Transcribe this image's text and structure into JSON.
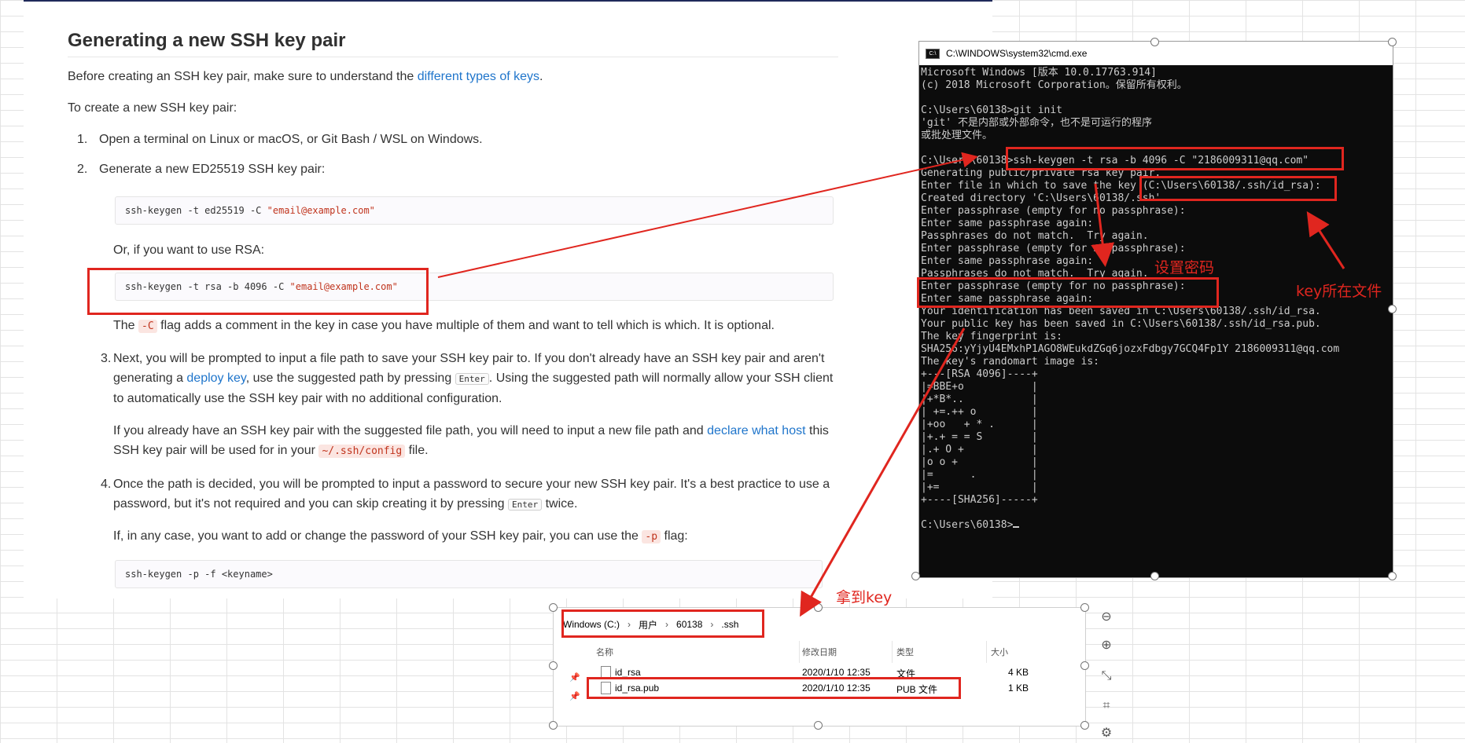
{
  "doc": {
    "title": "Generating a new SSH key pair",
    "intro_before": "Before creating an SSH key pair, make sure to understand the ",
    "intro_link": "different types of keys",
    "intro_after": ".",
    "create_intro": "To create a new SSH key pair:",
    "step1": {
      "num": "1.",
      "text": "Open a terminal on Linux or macOS, or Git Bash / WSL on Windows."
    },
    "step2": {
      "num": "2.",
      "text": "Generate a new ED25519 SSH key pair:"
    },
    "code1": {
      "cmd": "ssh-keygen -t ed25519 -C ",
      "str": "\"email@example.com\""
    },
    "rsa_intro": "Or, if you want to use RSA:",
    "code2": {
      "cmd": "ssh-keygen -t rsa -b 4096 -C ",
      "str": "\"email@example.com\""
    },
    "flag_pre": "The ",
    "flag_code": "-C",
    "flag_post": " flag adds a comment in the key in case you have multiple of them and want to tell which is which. It is optional.",
    "step3": {
      "num": "3.",
      "part1": "Next, you will be prompted to input a file path to save your SSH key pair to. If you don't already have an SSH key pair and aren't generating a ",
      "link": "deploy key",
      "part2": ", use the suggested path by pressing ",
      "kbd": "Enter",
      "part3": ". Using the suggested path will normally allow your SSH client to automatically use the SSH key pair with no additional configuration."
    },
    "step3b": {
      "part1": "If you already have an SSH key pair with the suggested file path, you will need to input a new file path and ",
      "link": "declare what host",
      "part2": " this SSH key pair will be used for in your ",
      "code": "~/.ssh/config",
      "part3": " file."
    },
    "step4": {
      "num": "4.",
      "part1": "Once the path is decided, you will be prompted to input a password to secure your new SSH key pair. It's a best practice to use a password, but it's not required and you can skip creating it by pressing ",
      "kbd": "Enter",
      "part2": " twice."
    },
    "step4b": {
      "part1": "If, in any case, you want to add or change the password of your SSH key pair, you can use the ",
      "code": "-p",
      "part2": " flag:"
    },
    "code3": {
      "cmd": "ssh-keygen -p -f <keyname>"
    }
  },
  "cmd": {
    "title": "C:\\WINDOWS\\system32\\cmd.exe",
    "icon_label": "C:\\",
    "lines": [
      "Microsoft Windows [版本 10.0.17763.914]",
      "(c) 2018 Microsoft Corporation。保留所有权利。",
      "",
      "C:\\Users\\60138>git init",
      "'git' 不是内部或外部命令，也不是可运行的程序",
      "或批处理文件。",
      "",
      "C:\\Users\\60138>ssh-keygen -t rsa -b 4096 -C \"2186009311@qq.com\"",
      "Generating public/private rsa key pair.",
      "Enter file in which to save the key (C:\\Users\\60138/.ssh/id_rsa):",
      "Created directory 'C:\\Users\\60138/.ssh'.",
      "Enter passphrase (empty for no passphrase):",
      "Enter same passphrase again:",
      "Passphrases do not match.  Try again.",
      "Enter passphrase (empty for no passphrase):",
      "Enter same passphrase again:",
      "Passphrases do not match.  Try again.",
      "Enter passphrase (empty for no passphrase):",
      "Enter same passphrase again:",
      "Your identification has been saved in C:\\Users\\60138/.ssh/id_rsa.",
      "Your public key has been saved in C:\\Users\\60138/.ssh/id_rsa.pub.",
      "The key fingerprint is:",
      "SHA256:yYjyU4EMxhP1AGO8WEukdZGq6jozxFdbgy7GCQ4Fp1Y 2186009311@qq.com",
      "The key's randomart image is:",
      "+---[RSA 4096]----+",
      "|=BBE+o           |",
      "|+*B*..           |",
      "| +=.++ o         |",
      "|+oo   + * .      |",
      "|+.+ = = S        |",
      "|.+ O +           |",
      "|o o +            |",
      "|=      .         |",
      "|+=               |",
      "+----[SHA256]-----+",
      "",
      "C:\\Users\\60138>"
    ]
  },
  "explorer": {
    "breadcrumb": [
      "Windows (C:)",
      "用户",
      "60138",
      ".ssh"
    ],
    "breadcrumb_sep": "›",
    "columns": {
      "name": "名称",
      "date": "修改日期",
      "type": "类型",
      "size": "大小"
    },
    "files": [
      {
        "name": "id_rsa",
        "date": "2020/1/10 12:35",
        "type": "文件",
        "size": "4 KB"
      },
      {
        "name": "id_rsa.pub",
        "date": "2020/1/10 12:35",
        "type": "PUB 文件",
        "size": "1 KB"
      }
    ]
  },
  "annotations": {
    "set_password": "设置密码",
    "key_file": "key所在文件",
    "get_key": "拿到key"
  },
  "colors": {
    "annotation_red": "#e0261f",
    "link_blue": "#1f75cb",
    "console_bg": "#0c0c0c"
  }
}
